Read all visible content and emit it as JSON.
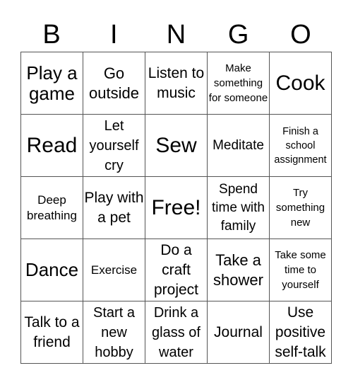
{
  "header": [
    "B",
    "I",
    "N",
    "G",
    "O"
  ],
  "cells": [
    "Play a game",
    "Go outside",
    "Listen to music",
    "Make something for someone",
    "Cook",
    "Read",
    "Let yourself cry",
    "Sew",
    "Meditate",
    "Finish a school assignment",
    "Deep breathing",
    "Play with a pet",
    "Free!",
    "Spend time with family",
    "Try something new",
    "Dance",
    "Exercise",
    "Do a craft project",
    "Take a shower",
    "Take some time to yourself",
    "Talk to a friend",
    "Start a new hobby",
    "Drink a glass of water",
    "Journal",
    "Use positive self-talk"
  ]
}
